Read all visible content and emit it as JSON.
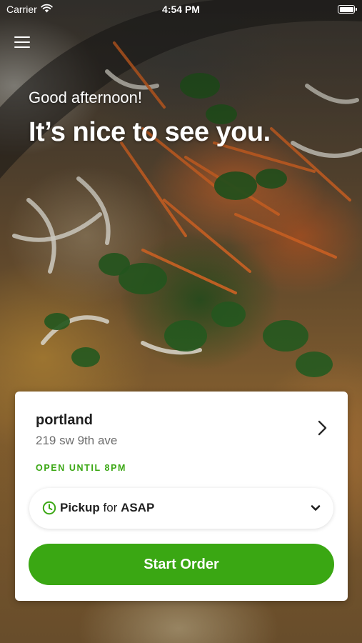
{
  "status_bar": {
    "carrier": "Carrier",
    "time": "4:54 PM",
    "wifi_icon": "wifi-icon",
    "battery_icon": "battery-icon"
  },
  "header": {
    "menu_icon": "hamburger-menu-icon",
    "greeting": "Good afternoon!",
    "headline": "It’s nice to see you."
  },
  "location_card": {
    "name": "portland",
    "address": "219 sw 9th ave",
    "open_status": "OPEN UNTIL 8PM",
    "chevron_icon": "chevron-right-icon",
    "order_mode": {
      "icon": "clock-icon",
      "mode": "Pickup",
      "connector": "for",
      "time": "ASAP",
      "dropdown_icon": "chevron-down-icon"
    },
    "start_button_label": "Start Order"
  },
  "colors": {
    "accent_green": "#3aa713",
    "card_background": "#ffffff",
    "text_primary": "#1f1f1f",
    "text_secondary": "#6e6e6e"
  }
}
